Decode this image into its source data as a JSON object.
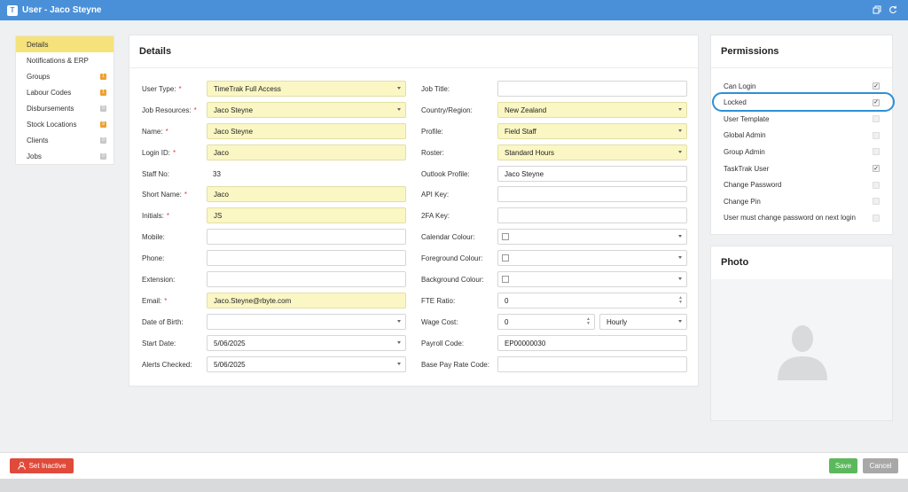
{
  "window": {
    "logo_text": "T",
    "title": "User - Jaco Steyne"
  },
  "nav": {
    "items": [
      {
        "label": "Details",
        "active": true
      },
      {
        "label": "Notifications & ERP"
      },
      {
        "label": "Groups",
        "badge": "1",
        "badge_color": "orange"
      },
      {
        "label": "Labour Codes",
        "badge": "1",
        "badge_color": "orange"
      },
      {
        "label": "Disbursements",
        "badge": "0",
        "badge_color": "gray"
      },
      {
        "label": "Stock Locations",
        "badge": "9",
        "badge_color": "orange"
      },
      {
        "label": "Clients",
        "badge": "0",
        "badge_color": "gray"
      },
      {
        "label": "Jobs",
        "badge": "0",
        "badge_color": "gray"
      }
    ]
  },
  "details": {
    "title": "Details",
    "left": [
      {
        "label": "User Type:",
        "required": true,
        "value": "TimeTrak Full Access",
        "type": "select",
        "highlight": true
      },
      {
        "label": "Job Resources:",
        "required": true,
        "value": "Jaco Steyne",
        "type": "select",
        "highlight": true
      },
      {
        "label": "Name:",
        "required": true,
        "value": "Jaco Steyne",
        "type": "text",
        "highlight": true
      },
      {
        "label": "Login ID:",
        "required": true,
        "value": "Jaco",
        "type": "text",
        "highlight": true
      },
      {
        "label": "Staff No:",
        "required": false,
        "value": "33",
        "type": "static"
      },
      {
        "label": "Short Name:",
        "required": true,
        "value": "Jaco",
        "type": "text",
        "highlight": true
      },
      {
        "label": "Initials:",
        "required": true,
        "value": "JS",
        "type": "text",
        "highlight": true
      },
      {
        "label": "Mobile:",
        "required": false,
        "value": "",
        "type": "text"
      },
      {
        "label": "Phone:",
        "required": false,
        "value": "",
        "type": "text"
      },
      {
        "label": "Extension:",
        "required": false,
        "value": "",
        "type": "text"
      },
      {
        "label": "Email:",
        "required": true,
        "value": "Jaco.Steyne@rbyte.com",
        "type": "text",
        "highlight": true
      },
      {
        "label": "Date of Birth:",
        "required": false,
        "value": "",
        "type": "select"
      },
      {
        "label": "Start Date:",
        "required": false,
        "value": "5/06/2025",
        "type": "select"
      },
      {
        "label": "Alerts Checked:",
        "required": false,
        "value": "5/06/2025",
        "type": "select"
      }
    ],
    "right": [
      {
        "label": "Job Title:",
        "value": "",
        "type": "text"
      },
      {
        "label": "Country/Region:",
        "value": "New Zealand",
        "type": "select",
        "highlight": true
      },
      {
        "label": "Profile:",
        "value": "Field Staff",
        "type": "select",
        "highlight": true
      },
      {
        "label": "Roster:",
        "value": "Standard Hours",
        "type": "select",
        "highlight": true
      },
      {
        "label": "Outlook Profile:",
        "value": "Jaco Steyne",
        "type": "text"
      },
      {
        "label": "API Key:",
        "value": "",
        "type": "text"
      },
      {
        "label": "2FA Key:",
        "value": "",
        "type": "text"
      },
      {
        "label": "Calendar Colour:",
        "value": "",
        "type": "color"
      },
      {
        "label": "Foreground Colour:",
        "value": "",
        "type": "color"
      },
      {
        "label": "Background Colour:",
        "value": "",
        "type": "color"
      },
      {
        "label": "FTE Ratio:",
        "value": "0",
        "type": "number"
      },
      {
        "label": "Wage Cost:",
        "value": "0",
        "type": "wage",
        "unit": "Hourly"
      },
      {
        "label": "Payroll Code:",
        "value": "EP00000030",
        "type": "text"
      },
      {
        "label": "Base Pay Rate Code:",
        "value": "",
        "type": "text"
      }
    ]
  },
  "permissions": {
    "title": "Permissions",
    "items": [
      {
        "label": "Can Login",
        "checked": true,
        "enabled": true
      },
      {
        "label": "Locked",
        "checked": true,
        "enabled": true
      },
      {
        "label": "User Template",
        "checked": false,
        "enabled": false
      },
      {
        "label": "Global Admin",
        "checked": false,
        "enabled": false
      },
      {
        "label": "Group Admin",
        "checked": false,
        "enabled": false
      },
      {
        "label": "TaskTrak User",
        "checked": true,
        "enabled": true
      },
      {
        "label": "Change Password",
        "checked": false,
        "enabled": false
      },
      {
        "label": "Change Pin",
        "checked": false,
        "enabled": false
      },
      {
        "label": "User must change password on next login",
        "checked": false,
        "enabled": false
      }
    ]
  },
  "photo": {
    "title": "Photo"
  },
  "footer": {
    "set_inactive": "Set Inactive",
    "save": "Save",
    "cancel": "Cancel"
  },
  "colors": {
    "titlebar": "#4a90d9",
    "required_bg": "#fbf7c4",
    "active_nav": "#f6e27a",
    "danger": "#e04a3a",
    "success": "#5cb85c"
  }
}
